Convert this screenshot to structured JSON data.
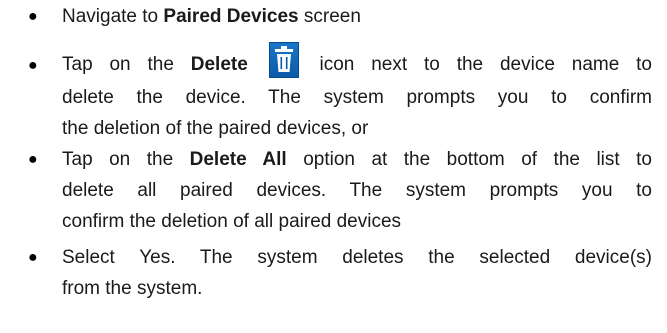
{
  "bullets": [
    {
      "symbol": "●",
      "parts": [
        {
          "text": "Navigate to ",
          "bold": false
        },
        {
          "text": "Paired Devices",
          "bold": true
        },
        {
          "text": " screen",
          "bold": false
        }
      ]
    },
    {
      "symbol": "●",
      "line1_pre": "Tap on the ",
      "line1_bold": "Delete",
      "line1_post": " icon next to the device name to",
      "line2": "delete the device. The system prompts you to confirm",
      "line3": "the deletion of the paired devices, or",
      "icon": "trash-icon"
    },
    {
      "symbol": "●",
      "line1_pre": "Tap on the ",
      "line1_bold": "Delete All",
      "line1_post": " option at the bottom of the list to",
      "line2": "delete all paired devices. The system prompts you to",
      "line3": "confirm the deletion of all paired devices"
    },
    {
      "symbol": "●",
      "line1": "Select Yes. The system deletes the selected device(s)",
      "line2": "from the system."
    }
  ],
  "colors": {
    "text": "#1a1a1a",
    "icon_bg": "#0b5aa8",
    "icon_fg": "#ffffff"
  }
}
